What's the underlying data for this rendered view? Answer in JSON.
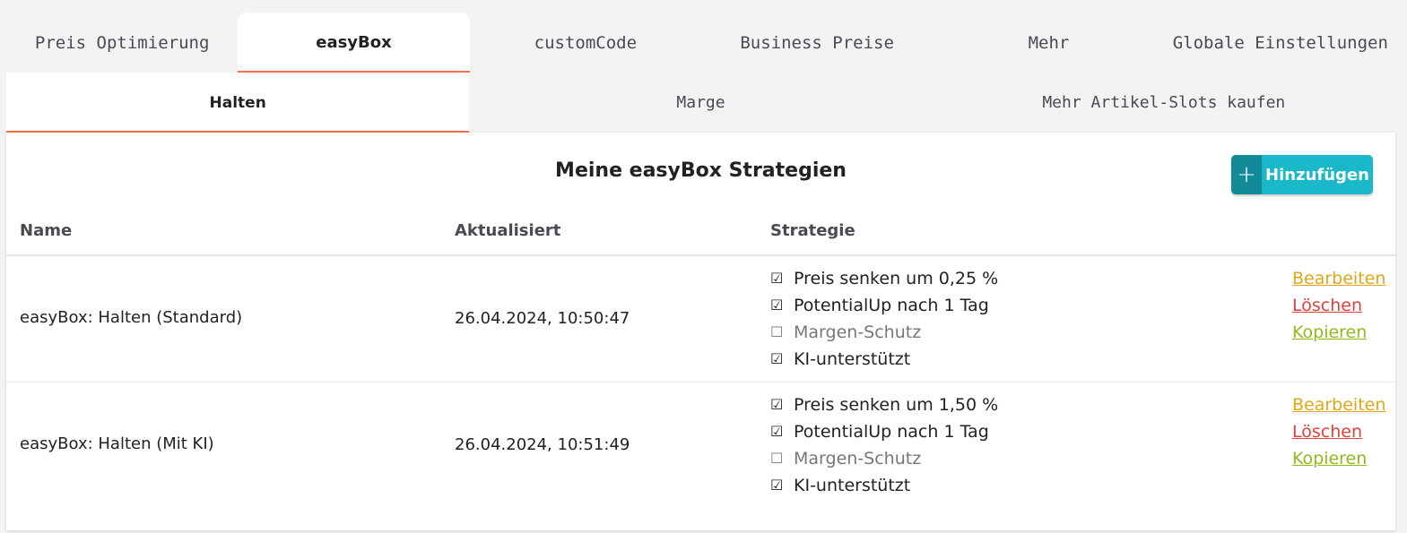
{
  "top_tabs": [
    "Preis Optimierung",
    "easyBox",
    "customCode",
    "Business Preise",
    "Mehr",
    "Globale Einstellungen"
  ],
  "top_tab_active": "easyBox",
  "sub_tabs": [
    "Halten",
    "Marge",
    "Mehr Artikel-Slots kaufen"
  ],
  "sub_tab_active": "Halten",
  "panel": {
    "title": "Meine easyBox Strategien",
    "add_button": "Hinzufügen"
  },
  "table": {
    "headers": {
      "name": "Name",
      "updated": "Aktualisiert",
      "strategy": "Strategie"
    },
    "rows": [
      {
        "name": "easyBox: Halten (Standard)",
        "updated": "26.04.2024, 10:50:47",
        "strategy": [
          {
            "text": "Preis senken um 0,25 %",
            "checked": true
          },
          {
            "text": "PotentialUp nach 1 Tag",
            "checked": true
          },
          {
            "text": "Margen-Schutz",
            "checked": false
          },
          {
            "text": "KI-unterstützt",
            "checked": true
          }
        ],
        "actions": {
          "edit": "Bearbeiten",
          "delete": "Löschen",
          "copy": "Kopieren"
        }
      },
      {
        "name": "easyBox: Halten (Mit KI)",
        "updated": "26.04.2024, 10:51:49",
        "strategy": [
          {
            "text": "Preis senken um 1,50 %",
            "checked": true
          },
          {
            "text": "PotentialUp nach 1 Tag",
            "checked": true
          },
          {
            "text": "Margen-Schutz",
            "checked": false
          },
          {
            "text": "KI-unterstützt",
            "checked": true
          }
        ],
        "actions": {
          "edit": "Bearbeiten",
          "delete": "Löschen",
          "copy": "Kopieren"
        }
      }
    ]
  },
  "colors": {
    "accent": "#f07050",
    "button": "#1ab8c8",
    "edit": "#e0a817",
    "delete": "#e0403a",
    "copy": "#8fbb1c"
  }
}
